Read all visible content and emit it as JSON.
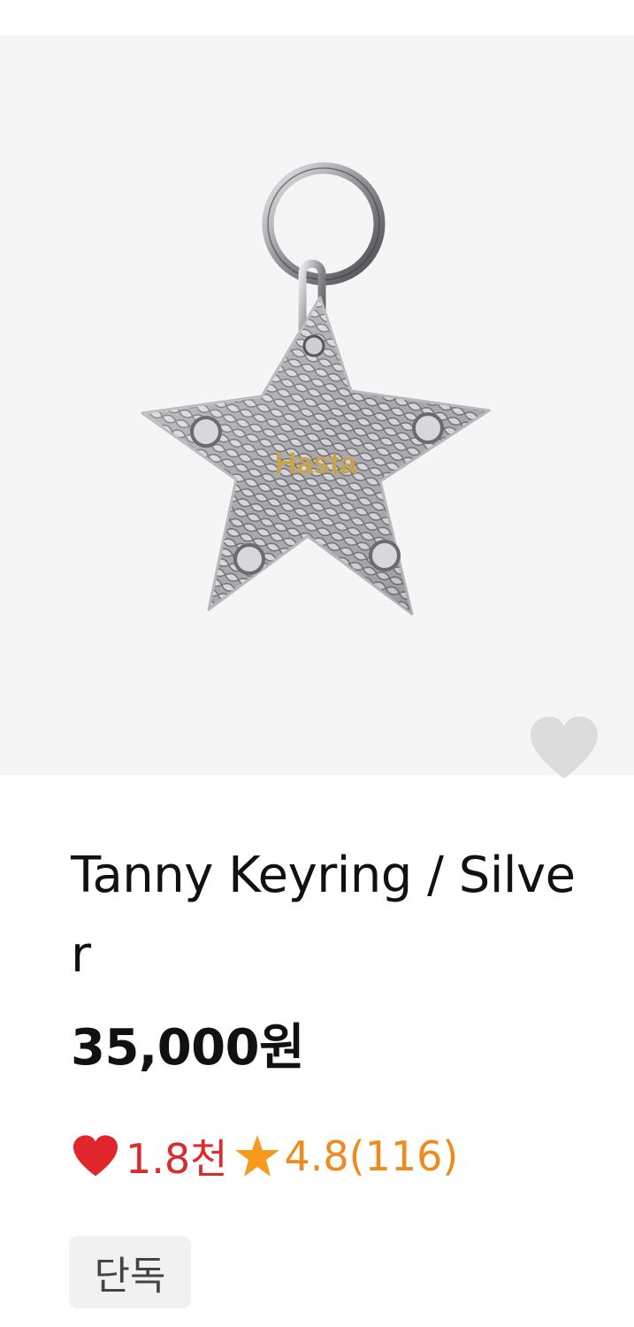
{
  "product": {
    "title": "Tanny Keyring / Silver",
    "price": "35,000원",
    "likes": "1.8천",
    "rating": "4.8(116)",
    "badge": "단독",
    "image_alt": "silver star keyring",
    "image_logo_text": "Hasta"
  },
  "colors": {
    "like_red": "#e0262b",
    "rating_orange": "#f59a1a",
    "wish_heart": "#dcdcdc",
    "image_bg": "#f5f5f5"
  },
  "icons": {
    "wish": "heart-icon",
    "likes": "heart-icon",
    "rating": "star-icon"
  }
}
